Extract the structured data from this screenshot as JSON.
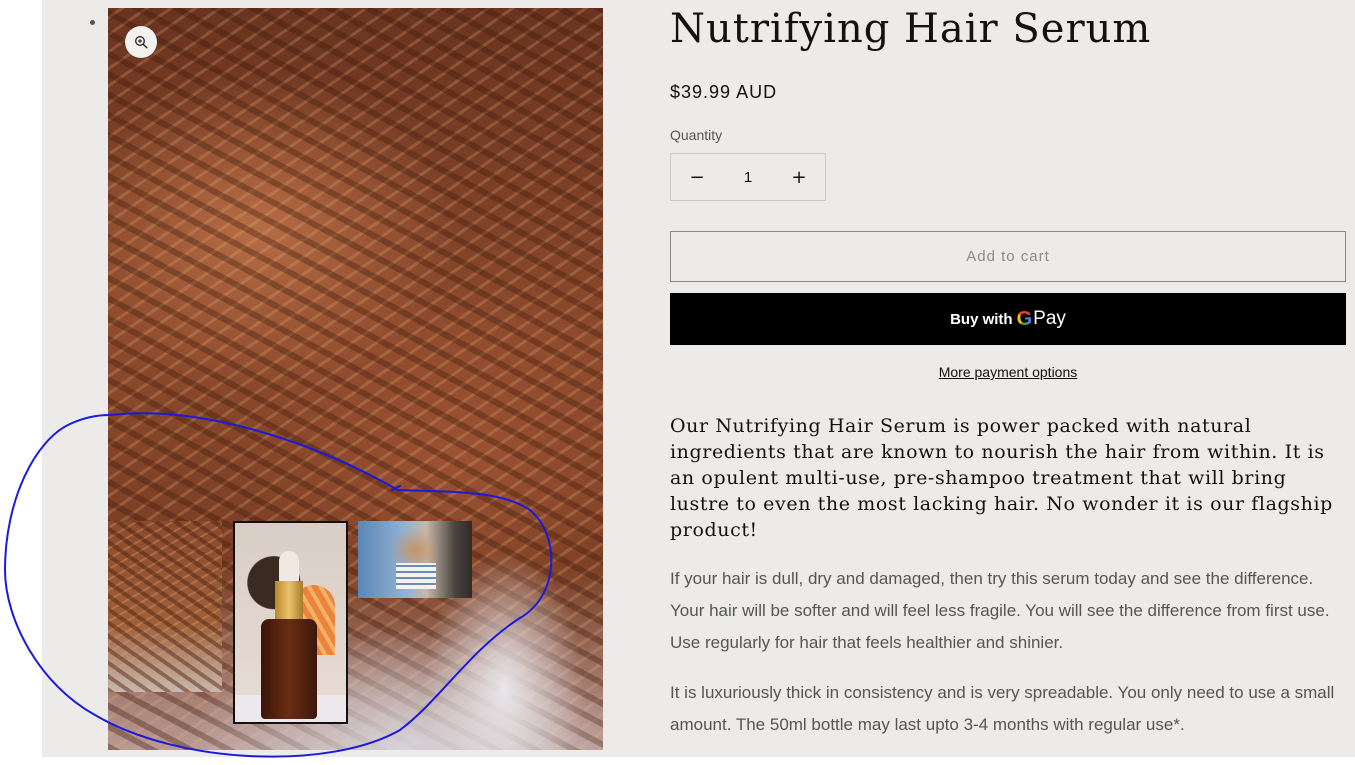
{
  "product": {
    "title": "Nutrifying Hair Serum",
    "price": "$39.99 AUD",
    "quantity_label": "Quantity",
    "quantity_value": "1",
    "decrement_glyph": "−",
    "increment_glyph": "+",
    "add_to_cart_label": "Add to cart",
    "gpay_buy_with": "Buy with",
    "gpay_g": "G",
    "gpay_pay": "Pay",
    "more_payment_label": "More payment options"
  },
  "description": {
    "lead": "Our Nutrifying Hair Serum is power packed with natural ingredients that are known to nourish the hair from within. It is an opulent multi-use, pre-shampoo treatment that will bring lustre to even the most lacking hair. No wonder it is our flagship product!",
    "paragraph_2": "If your hair is dull, dry and damaged, then try this serum today and see the difference. Your hair will be softer and will feel less fragile. You will see the difference from first use. Use regularly for hair that feels healthier and shinier.",
    "paragraph_3": "It is luxuriously thick in consistency and is very spreadable. You only need to use a small amount. The 50ml bottle may last upto 3-4 months with regular use*."
  },
  "media": {
    "zoom_icon": "zoom-in-icon",
    "thumbnails": [
      "curly-hair-thumbnail",
      "serum-bottle-thumbnail",
      "hair-outdoors-thumbnail"
    ]
  },
  "colors": {
    "page_background": "#ecebe9",
    "text": "#121212",
    "muted_text": "#555555",
    "gpay_button": "#000000",
    "annotation_stroke": "#1a1adb",
    "google_blue": "#4285F4",
    "google_red": "#EA4335",
    "google_yellow": "#FBBC05",
    "google_green": "#34A853"
  }
}
